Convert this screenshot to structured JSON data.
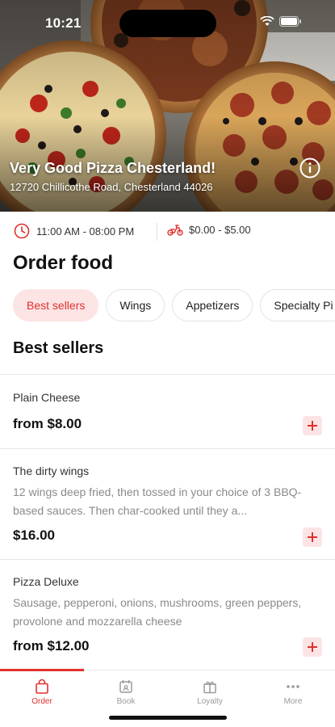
{
  "status": {
    "time": "10:21"
  },
  "restaurant": {
    "name": "Very Good Pizza Chesterland!",
    "address": "12720 Chillicothe Road, Chesterland 44026",
    "hours": "11:00 AM - 08:00 PM",
    "delivery_fee": "$0.00 - $5.00"
  },
  "page": {
    "title": "Order food",
    "section_title": "Best sellers"
  },
  "categories": [
    "Best sellers",
    "Wings",
    "Appetizers",
    "Specialty Pi"
  ],
  "items": [
    {
      "name": "Plain Cheese",
      "desc": "",
      "price": "from $8.00"
    },
    {
      "name": "The dirty wings",
      "desc": "12 wings deep fried, then tossed in your choice of 3 BBQ-based sauces. Then char-cooked until they a...",
      "price": "$16.00"
    },
    {
      "name": "Pizza Deluxe",
      "desc": "Sausage, pepperoni, onions, mushrooms, green peppers, provolone and mozzarella cheese",
      "price": "from $12.00"
    }
  ],
  "tabs": [
    {
      "label": "Order",
      "icon": "bag-icon"
    },
    {
      "label": "Book",
      "icon": "book-icon"
    },
    {
      "label": "Loyalty",
      "icon": "gift-icon"
    },
    {
      "label": "More",
      "icon": "more-icon"
    }
  ],
  "colors": {
    "accent": "#e0312f",
    "accent_light": "#fde4e4"
  }
}
